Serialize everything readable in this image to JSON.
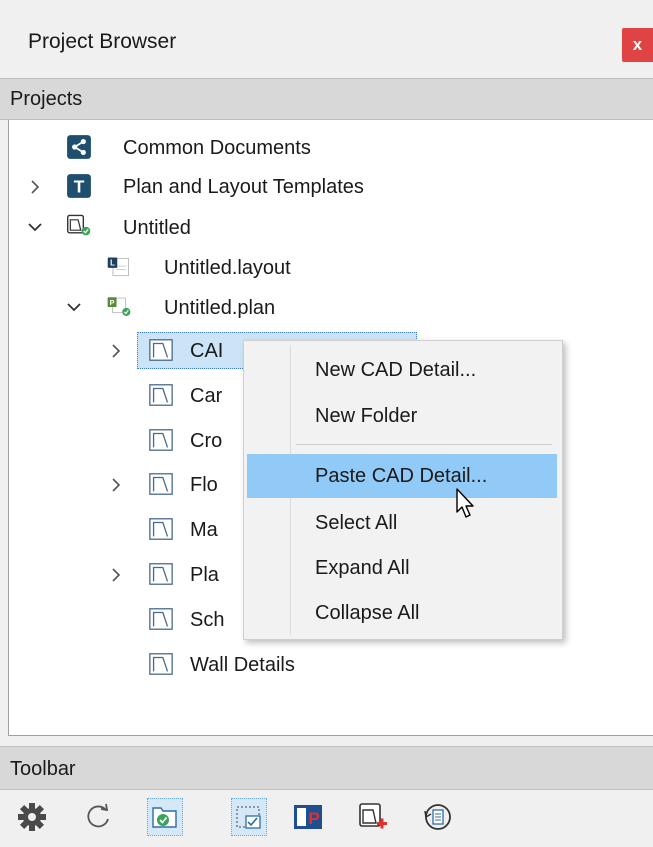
{
  "window": {
    "title": "Project Browser",
    "close_label": "x"
  },
  "projects_section": {
    "header": "Projects"
  },
  "tree": {
    "common_documents": "Common Documents",
    "plan_layout_templates": "Plan and Layout Templates",
    "untitled": "Untitled",
    "untitled_layout": "Untitled.layout",
    "untitled_plan": "Untitled.plan",
    "folders": [
      {
        "label": "CAI",
        "expandable": true
      },
      {
        "label": "Car",
        "expandable": false
      },
      {
        "label": "Cro",
        "expandable": false
      },
      {
        "label": "Flo",
        "expandable": true
      },
      {
        "label": "Ma",
        "expandable": false
      },
      {
        "label": "Pla",
        "expandable": true
      },
      {
        "label": "Sch",
        "expandable": false
      },
      {
        "label": "Wall Details",
        "expandable": false
      }
    ]
  },
  "context_menu": {
    "items": [
      {
        "label": "New CAD Detail..."
      },
      {
        "label": "New Folder"
      },
      {
        "label": "Paste CAD Detail...",
        "highlighted": true
      },
      {
        "label": "Select All"
      },
      {
        "label": "Expand All"
      },
      {
        "label": "Collapse All"
      }
    ]
  },
  "toolbar_section": {
    "header": "Toolbar",
    "buttons": [
      {
        "icon": "gear-icon"
      },
      {
        "icon": "refresh-icon"
      },
      {
        "icon": "open-folder-icon",
        "active": true
      },
      {
        "icon": "select-folder-icon",
        "active": true
      },
      {
        "icon": "plan-icon"
      },
      {
        "icon": "new-document-icon"
      },
      {
        "icon": "history-icon"
      }
    ]
  },
  "colors": {
    "accent_highlight": "#91c9f7",
    "selection": "#cce4f7",
    "close_button": "#e04343"
  }
}
